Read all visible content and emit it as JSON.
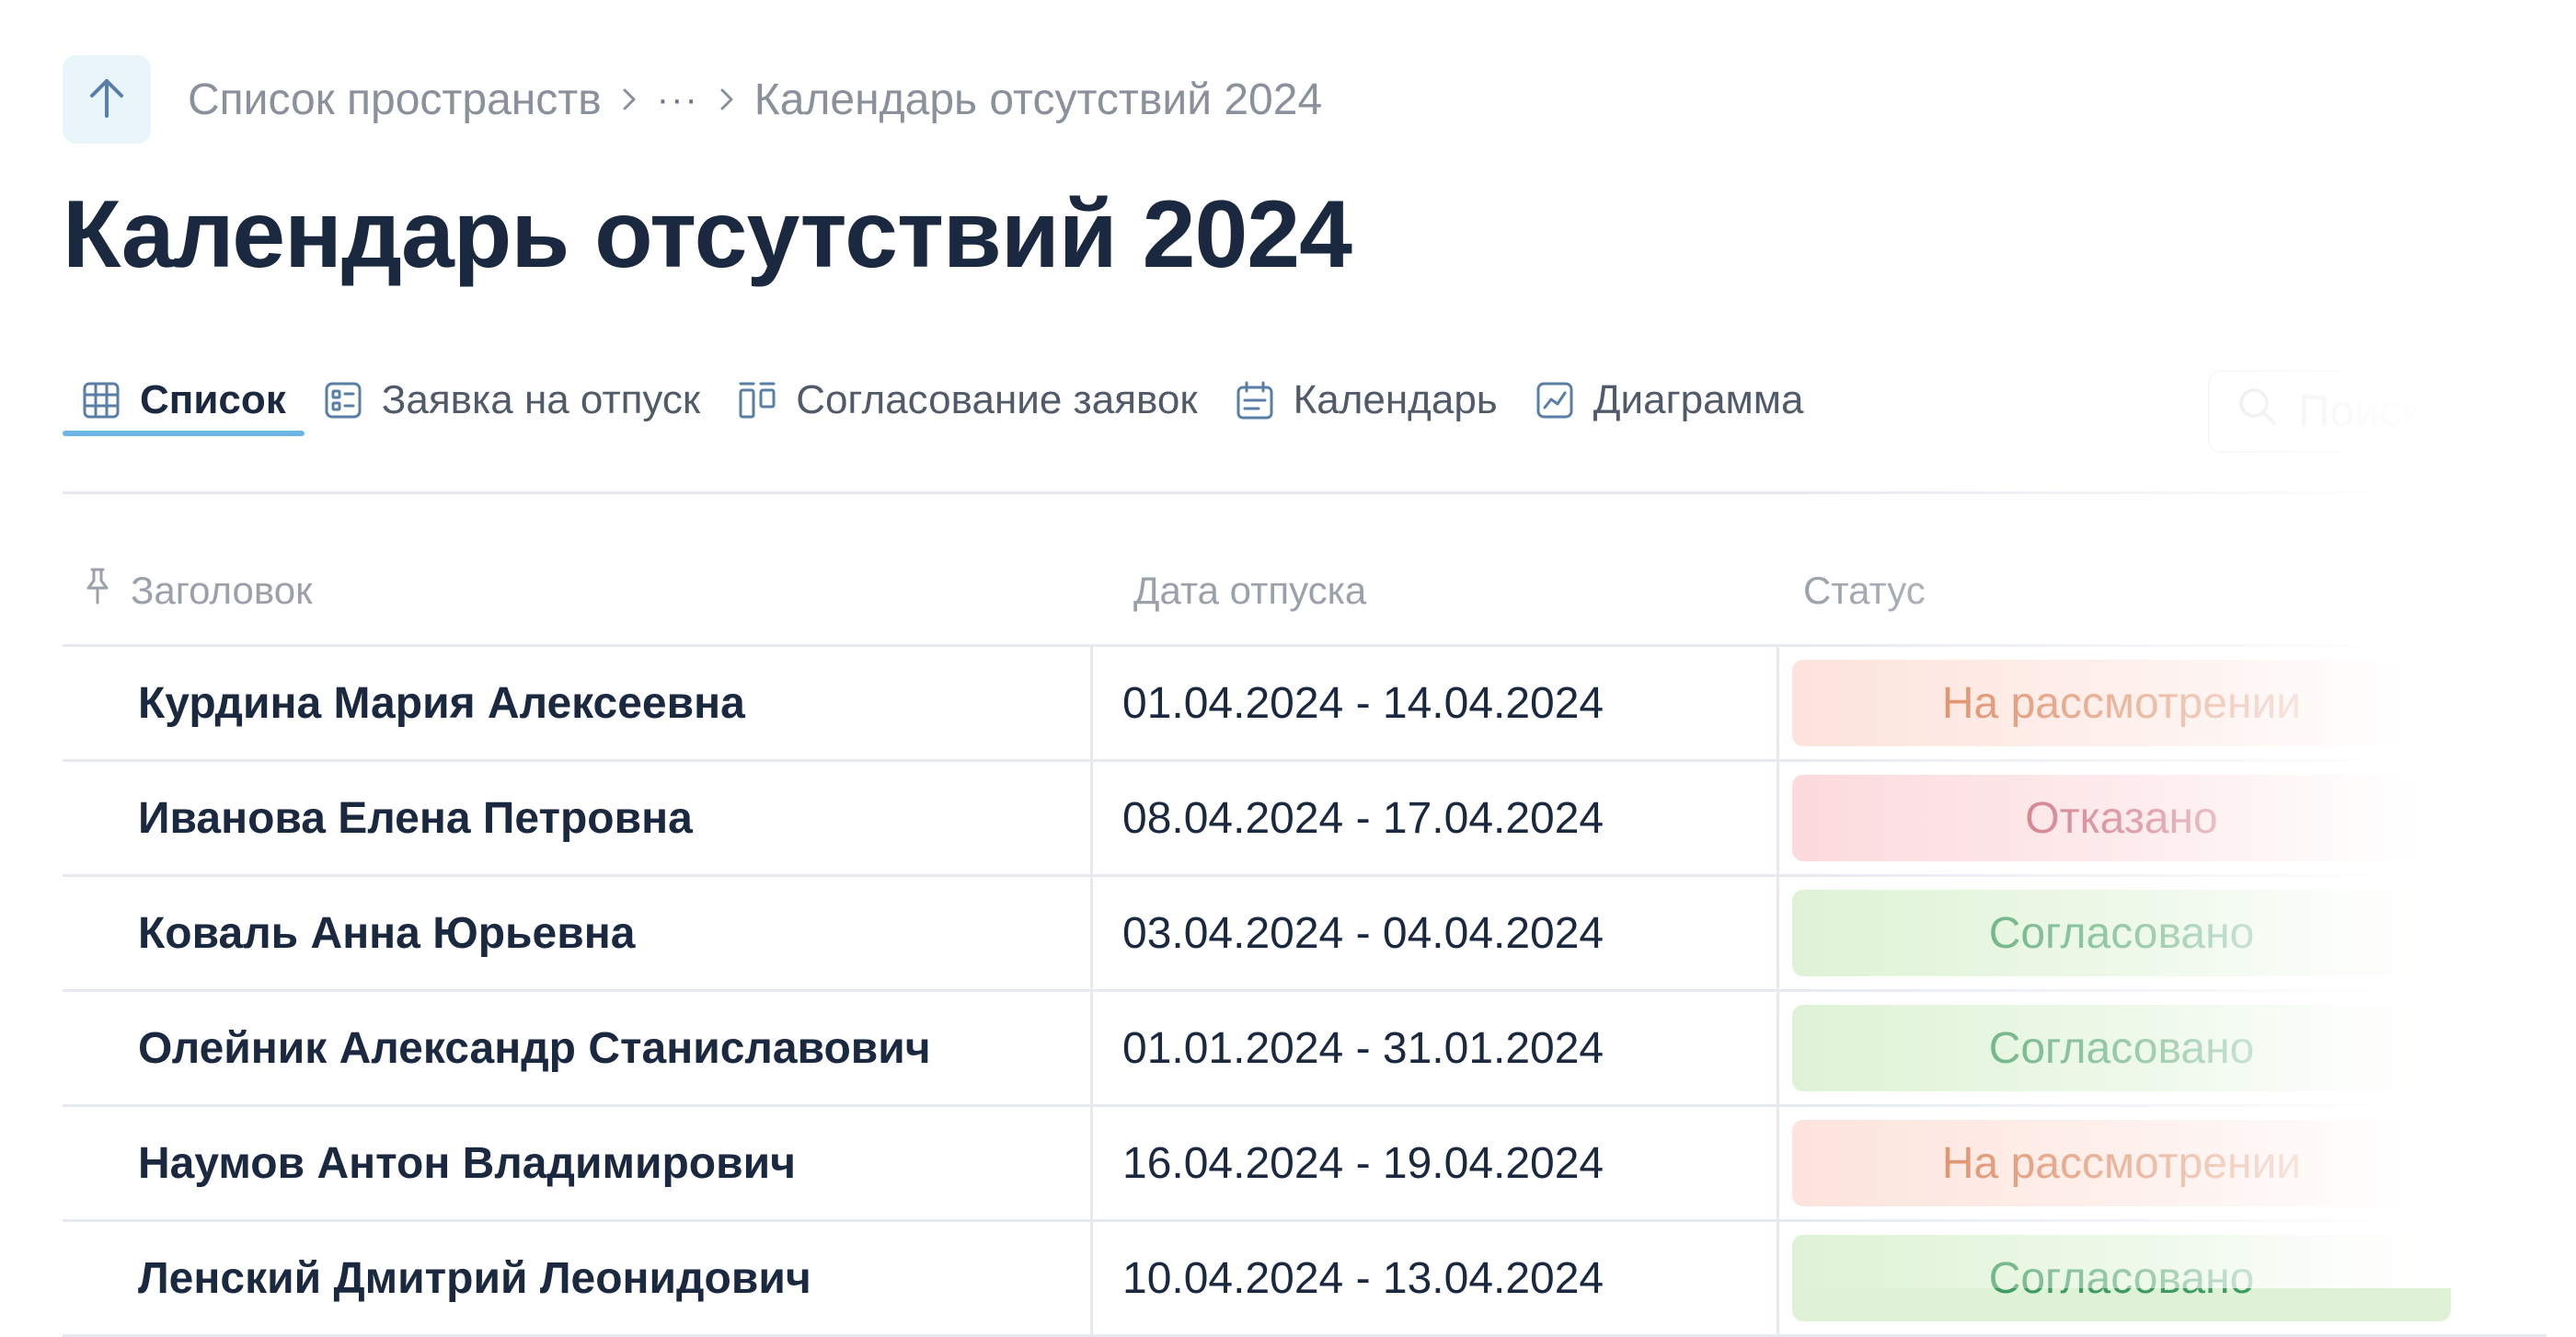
{
  "breadcrumb": {
    "items": [
      "Список пространств",
      "···",
      "Календарь отсутствий 2024"
    ]
  },
  "page": {
    "title": "Календарь отсутствий 2024"
  },
  "tabs": [
    {
      "label": "Список",
      "icon": "table-grid-icon",
      "active": true
    },
    {
      "label": "Заявка на отпуск",
      "icon": "form-icon",
      "active": false
    },
    {
      "label": "Согласование заявок",
      "icon": "kanban-icon",
      "active": false
    },
    {
      "label": "Календарь",
      "icon": "calendar-icon",
      "active": false
    },
    {
      "label": "Диаграмма",
      "icon": "chart-icon",
      "active": false
    }
  ],
  "search": {
    "placeholder": "Поиск"
  },
  "table": {
    "columns": [
      "Заголовок",
      "Дата отпуска",
      "Статус"
    ],
    "rows": [
      {
        "name": "Курдина Мария Алексеевна",
        "dates": "01.04.2024 - 14.04.2024",
        "status": "На рассмотрении"
      },
      {
        "name": "Иванова Елена Петровна",
        "dates": "08.04.2024 - 17.04.2024",
        "status": "Отказано"
      },
      {
        "name": "Коваль Анна Юрьевна",
        "dates": "03.04.2024 - 04.04.2024",
        "status": "Согласовано"
      },
      {
        "name": "Олейник Александр Станиславович",
        "dates": "01.01.2024 - 31.01.2024",
        "status": "Согласовано"
      },
      {
        "name": "Наумов Антон Владимирович",
        "dates": "16.04.2024 - 19.04.2024",
        "status": "На рассмотрении"
      },
      {
        "name": "Ленский Дмитрий Леонидович",
        "dates": "10.04.2024 - 13.04.2024",
        "status": "Согласовано"
      }
    ]
  },
  "colors": {
    "accent": "#6cb6e6",
    "title": "#1b2940",
    "status_review_bg": "#fde3dc",
    "status_refused_bg": "#fcdadd",
    "status_approved_bg": "#def3d5"
  }
}
